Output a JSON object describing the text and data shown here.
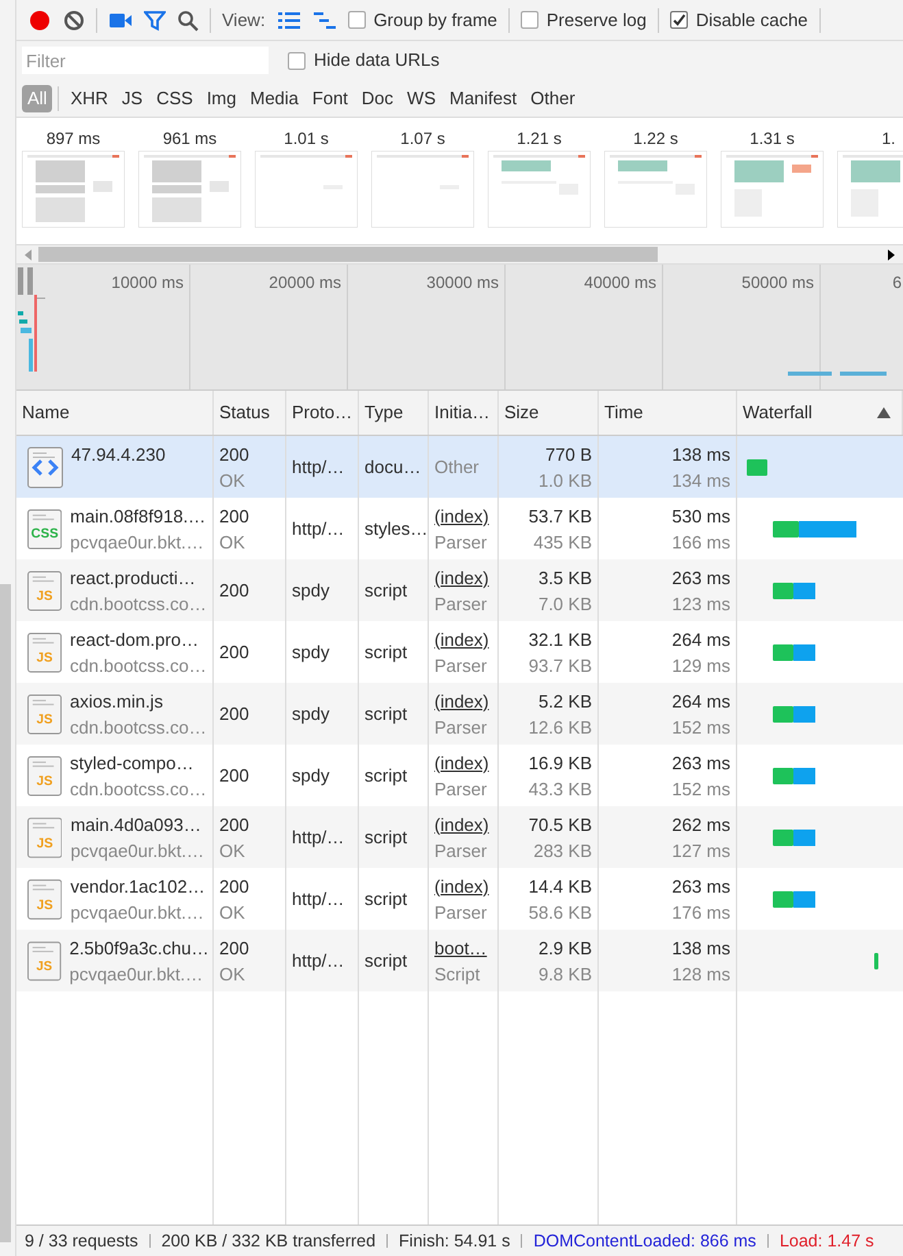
{
  "toolbar": {
    "record": {
      "on": true
    },
    "camera": {
      "on": true
    },
    "filter": {
      "on": true
    },
    "view_label": "View:",
    "view_modes": [
      {
        "kind": "list",
        "selected": true
      },
      {
        "kind": "waterfall",
        "selected": true
      }
    ],
    "checkboxes": [
      {
        "label": "Group by frame",
        "checked": false
      },
      {
        "label": "Preserve log",
        "checked": false
      },
      {
        "label": "Disable cache",
        "checked": true
      }
    ]
  },
  "filter_bar": {
    "placeholder": "Filter",
    "hide_data_urls": {
      "label": "Hide data URLs",
      "checked": false
    }
  },
  "type_filters": [
    {
      "label": "All",
      "selected": true
    },
    {
      "label": "XHR",
      "selected": false
    },
    {
      "label": "JS",
      "selected": false
    },
    {
      "label": "CSS",
      "selected": false
    },
    {
      "label": "Img",
      "selected": false
    },
    {
      "label": "Media",
      "selected": false
    },
    {
      "label": "Font",
      "selected": false
    },
    {
      "label": "Doc",
      "selected": false
    },
    {
      "label": "WS",
      "selected": false
    },
    {
      "label": "Manifest",
      "selected": false
    },
    {
      "label": "Other",
      "selected": false
    }
  ],
  "filmstrip": [
    {
      "time": "897 ms",
      "kind": "skeleton"
    },
    {
      "time": "961 ms",
      "kind": "skeleton"
    },
    {
      "time": "1.01 s",
      "kind": "blank"
    },
    {
      "time": "1.07 s",
      "kind": "blank"
    },
    {
      "time": "1.21 s",
      "kind": "banner"
    },
    {
      "time": "1.22 s",
      "kind": "banner"
    },
    {
      "time": "1.31 s",
      "kind": "full"
    },
    {
      "time": "1.",
      "kind": "full"
    }
  ],
  "overview": {
    "ticks": [
      "10000 ms",
      "20000 ms",
      "30000 ms",
      "40000 ms",
      "50000 ms",
      "6"
    ]
  },
  "table": {
    "columns": [
      "Name",
      "Status",
      "Proto…",
      "Type",
      "Initia…",
      "Size",
      "Time",
      "Waterfall"
    ],
    "rows": [
      {
        "kind": "doc",
        "icon_label": "",
        "name": "47.94.4.230",
        "domain": "",
        "status": "200",
        "status_text": "OK",
        "protocol": "http/…",
        "type": "docu…",
        "initiator": "",
        "initiator_detail": "Other",
        "size": "770 B",
        "resource_size": "1.0 KB",
        "time": "138 ms",
        "latency": "134 ms",
        "waterfall": {
          "kind": "doc"
        },
        "selected": true
      },
      {
        "kind": "css",
        "icon_label": "CSS",
        "name": "main.08f8f918.…",
        "domain": "pcvqae0ur.bkt.…",
        "status": "200",
        "status_text": "OK",
        "protocol": "http/…",
        "type": "styles…",
        "initiator": "(index)",
        "initiator_detail": "Parser",
        "size": "53.7 KB",
        "resource_size": "435 KB",
        "time": "530 ms",
        "latency": "166 ms",
        "waterfall": {
          "kind": "long"
        },
        "selected": false
      },
      {
        "kind": "js",
        "icon_label": "JS",
        "name": "react.producti…",
        "domain": "cdn.bootcss.co…",
        "status": "200",
        "status_text": "",
        "protocol": "spdy",
        "type": "script",
        "initiator": "(index)",
        "initiator_detail": "Parser",
        "size": "3.5 KB",
        "resource_size": "7.0 KB",
        "time": "263 ms",
        "latency": "123 ms",
        "waterfall": {
          "kind": "short"
        },
        "selected": false
      },
      {
        "kind": "js",
        "icon_label": "JS",
        "name": "react-dom.pro…",
        "domain": "cdn.bootcss.co…",
        "status": "200",
        "status_text": "",
        "protocol": "spdy",
        "type": "script",
        "initiator": "(index)",
        "initiator_detail": "Parser",
        "size": "32.1 KB",
        "resource_size": "93.7 KB",
        "time": "264 ms",
        "latency": "129 ms",
        "waterfall": {
          "kind": "short"
        },
        "selected": false
      },
      {
        "kind": "js",
        "icon_label": "JS",
        "name": "axios.min.js",
        "domain": "cdn.bootcss.co…",
        "status": "200",
        "status_text": "",
        "protocol": "spdy",
        "type": "script",
        "initiator": "(index)",
        "initiator_detail": "Parser",
        "size": "5.2 KB",
        "resource_size": "12.6 KB",
        "time": "264 ms",
        "latency": "152 ms",
        "waterfall": {
          "kind": "short"
        },
        "selected": false
      },
      {
        "kind": "js",
        "icon_label": "JS",
        "name": "styled-compo…",
        "domain": "cdn.bootcss.co…",
        "status": "200",
        "status_text": "",
        "protocol": "spdy",
        "type": "script",
        "initiator": "(index)",
        "initiator_detail": "Parser",
        "size": "16.9 KB",
        "resource_size": "43.3 KB",
        "time": "263 ms",
        "latency": "152 ms",
        "waterfall": {
          "kind": "short"
        },
        "selected": false
      },
      {
        "kind": "js",
        "icon_label": "JS",
        "name": "main.4d0a093…",
        "domain": "pcvqae0ur.bkt.…",
        "status": "200",
        "status_text": "OK",
        "protocol": "http/…",
        "type": "script",
        "initiator": "(index)",
        "initiator_detail": "Parser",
        "size": "70.5 KB",
        "resource_size": "283 KB",
        "time": "262 ms",
        "latency": "127 ms",
        "waterfall": {
          "kind": "short"
        },
        "selected": false
      },
      {
        "kind": "js",
        "icon_label": "JS",
        "name": "vendor.1ac102…",
        "domain": "pcvqae0ur.bkt.…",
        "status": "200",
        "status_text": "OK",
        "protocol": "http/…",
        "type": "script",
        "initiator": "(index)",
        "initiator_detail": "Parser",
        "size": "14.4 KB",
        "resource_size": "58.6 KB",
        "time": "263 ms",
        "latency": "176 ms",
        "waterfall": {
          "kind": "short"
        },
        "selected": false
      },
      {
        "kind": "js",
        "icon_label": "JS",
        "name": "2.5b0f9a3c.chu…",
        "domain": "pcvqae0ur.bkt.…",
        "status": "200",
        "status_text": "OK",
        "protocol": "http/…",
        "type": "script",
        "initiator": "boot…",
        "initiator_detail": "Script",
        "size": "2.9 KB",
        "resource_size": "9.8 KB",
        "time": "138 ms",
        "latency": "128 ms",
        "waterfall": {
          "kind": "edge"
        },
        "selected": false
      }
    ]
  },
  "status_bar": [
    {
      "kind": "plain",
      "text": "9 / 33 requests"
    },
    {
      "kind": "plain",
      "text": "200 KB / 332 KB transferred"
    },
    {
      "kind": "plain",
      "text": "Finish: 54.91 s"
    },
    {
      "kind": "dom",
      "text": "DOMContentLoaded: 866 ms"
    },
    {
      "kind": "load",
      "text": "Load: 1.47 s"
    }
  ]
}
